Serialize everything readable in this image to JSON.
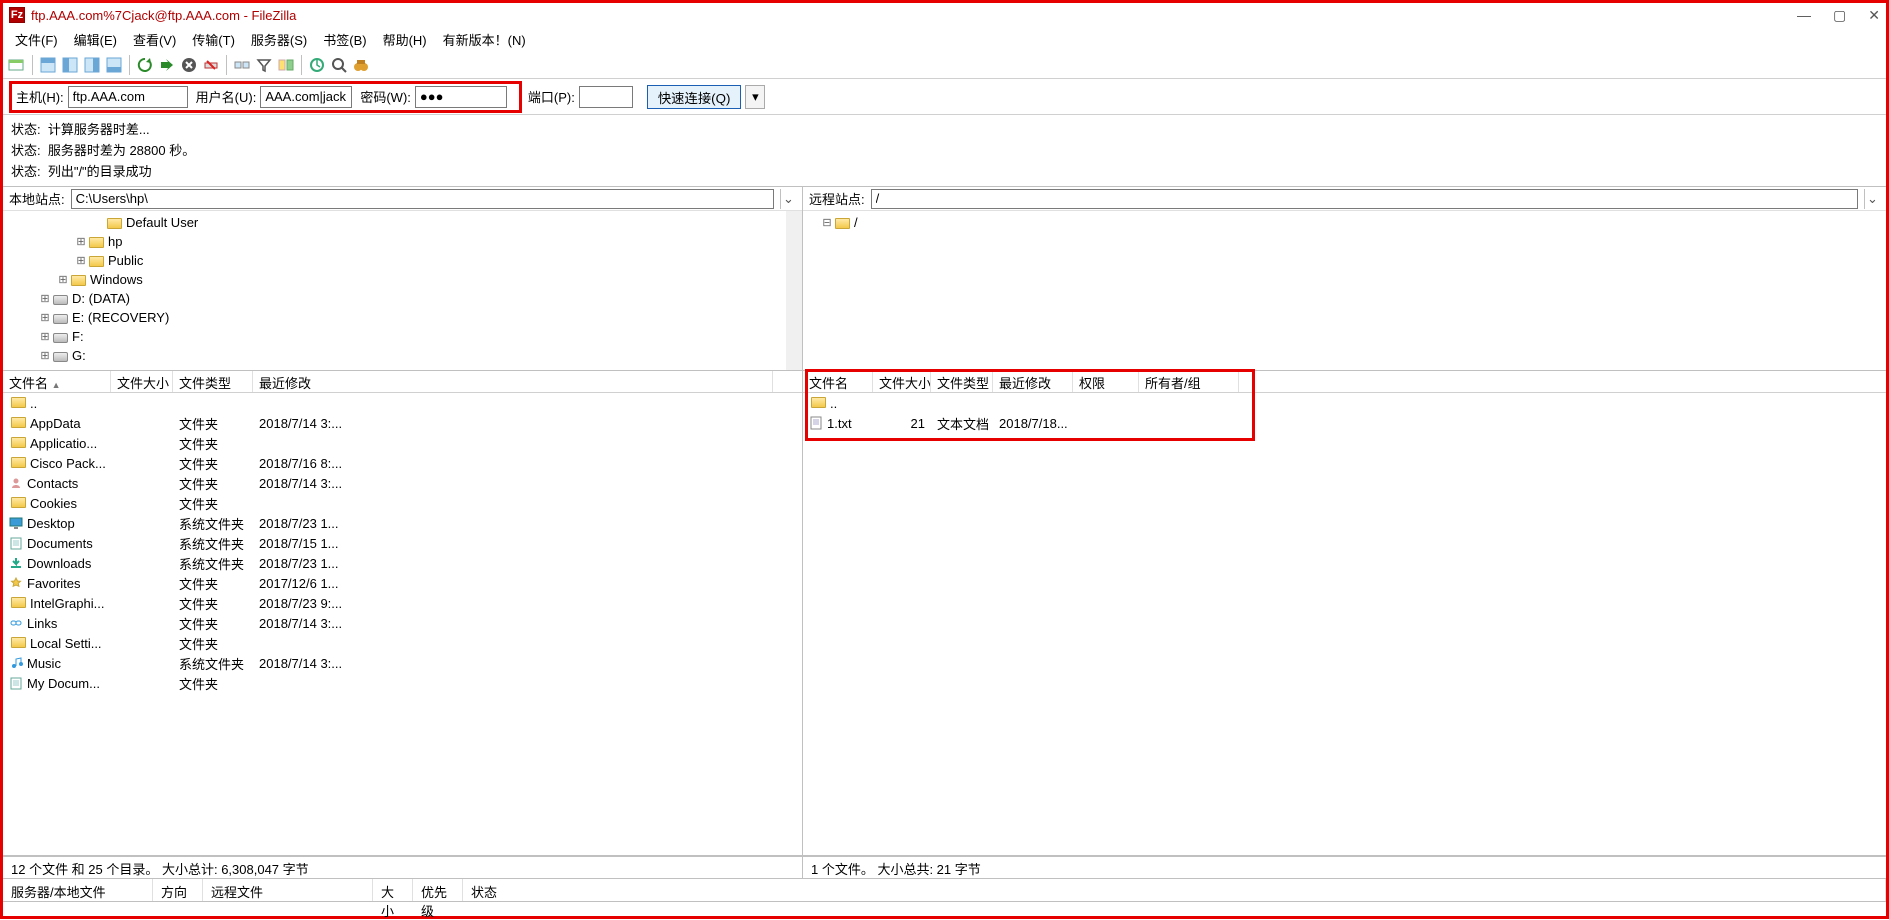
{
  "title": "ftp.AAA.com%7Cjack@ftp.AAA.com - FileZilla",
  "menu": [
    "文件(F)",
    "编辑(E)",
    "查看(V)",
    "传输(T)",
    "服务器(S)",
    "书签(B)",
    "帮助(H)",
    "有新版本！(N)"
  ],
  "quickconnect": {
    "host_label": "主机(H):",
    "host": "ftp.AAA.com",
    "user_label": "用户名(U):",
    "user": "AAA.com|jack",
    "pass_label": "密码(W):",
    "pass": "●●●",
    "port_label": "端口(P):",
    "port": "",
    "button": "快速连接(Q)"
  },
  "log": [
    "状态:  计算服务器时差...",
    "状态:  服务器时差为 28800 秒。",
    "状态:  列出\"/\"的目录成功"
  ],
  "local": {
    "site_label": "本地站点:",
    "path": "C:\\Users\\hp\\",
    "tree": [
      {
        "indent": 5,
        "expander": "",
        "icon": "folder",
        "label": "Default User"
      },
      {
        "indent": 4,
        "expander": "⊞",
        "icon": "folder",
        "label": "hp"
      },
      {
        "indent": 4,
        "expander": "⊞",
        "icon": "folder",
        "label": "Public"
      },
      {
        "indent": 3,
        "expander": "⊞",
        "icon": "folder",
        "label": "Windows"
      },
      {
        "indent": 2,
        "expander": "⊞",
        "icon": "drive",
        "label": "D: (DATA)"
      },
      {
        "indent": 2,
        "expander": "⊞",
        "icon": "drive",
        "label": "E: (RECOVERY)"
      },
      {
        "indent": 2,
        "expander": "⊞",
        "icon": "drive",
        "label": "F:"
      },
      {
        "indent": 2,
        "expander": "⊞",
        "icon": "drive",
        "label": "G:"
      }
    ],
    "cols": [
      "文件名",
      "文件大小",
      "文件类型",
      "最近修改"
    ],
    "rows": [
      {
        "name": "..",
        "size": "",
        "type": "",
        "mod": "",
        "icon": "folder"
      },
      {
        "name": "AppData",
        "size": "",
        "type": "文件夹",
        "mod": "2018/7/14 3:...",
        "icon": "folder"
      },
      {
        "name": "Applicatio...",
        "size": "",
        "type": "文件夹",
        "mod": "",
        "icon": "folder"
      },
      {
        "name": "Cisco Pack...",
        "size": "",
        "type": "文件夹",
        "mod": "2018/7/16 8:...",
        "icon": "folder"
      },
      {
        "name": "Contacts",
        "size": "",
        "type": "文件夹",
        "mod": "2018/7/14 3:...",
        "icon": "contacts"
      },
      {
        "name": "Cookies",
        "size": "",
        "type": "文件夹",
        "mod": "",
        "icon": "folder"
      },
      {
        "name": "Desktop",
        "size": "",
        "type": "系统文件夹",
        "mod": "2018/7/23 1...",
        "icon": "desktop"
      },
      {
        "name": "Documents",
        "size": "",
        "type": "系统文件夹",
        "mod": "2018/7/15 1...",
        "icon": "docs"
      },
      {
        "name": "Downloads",
        "size": "",
        "type": "系统文件夹",
        "mod": "2018/7/23 1...",
        "icon": "downloads"
      },
      {
        "name": "Favorites",
        "size": "",
        "type": "文件夹",
        "mod": "2017/12/6 1...",
        "icon": "fav"
      },
      {
        "name": "IntelGraphi...",
        "size": "",
        "type": "文件夹",
        "mod": "2018/7/23 9:...",
        "icon": "folder"
      },
      {
        "name": "Links",
        "size": "",
        "type": "文件夹",
        "mod": "2018/7/14 3:...",
        "icon": "links"
      },
      {
        "name": "Local Setti...",
        "size": "",
        "type": "文件夹",
        "mod": "",
        "icon": "folder"
      },
      {
        "name": "Music",
        "size": "",
        "type": "系统文件夹",
        "mod": "2018/7/14 3:...",
        "icon": "music"
      },
      {
        "name": "My Docum...",
        "size": "",
        "type": "文件夹",
        "mod": "",
        "icon": "docs"
      }
    ],
    "status": "12 个文件 和 25 个目录。 大小总计: 6,308,047 字节"
  },
  "remote": {
    "site_label": "远程站点:",
    "path": "/",
    "tree": [
      {
        "indent": 1,
        "expander": "⊟",
        "icon": "folder",
        "label": "/"
      }
    ],
    "cols": [
      "文件名",
      "文件大小",
      "文件类型",
      "最近修改",
      "权限",
      "所有者/组"
    ],
    "rows": [
      {
        "name": "..",
        "size": "",
        "type": "",
        "mod": "",
        "perm": "",
        "own": "",
        "icon": "folder"
      },
      {
        "name": "1.txt",
        "size": "21",
        "type": "文本文档",
        "mod": "2018/7/18...",
        "perm": "",
        "own": "",
        "icon": "txt"
      }
    ],
    "status": "1 个文件。 大小总共: 21 字节"
  },
  "queue_cols": [
    "服务器/本地文件",
    "方向",
    "远程文件",
    "大小",
    "优先级",
    "状态"
  ]
}
